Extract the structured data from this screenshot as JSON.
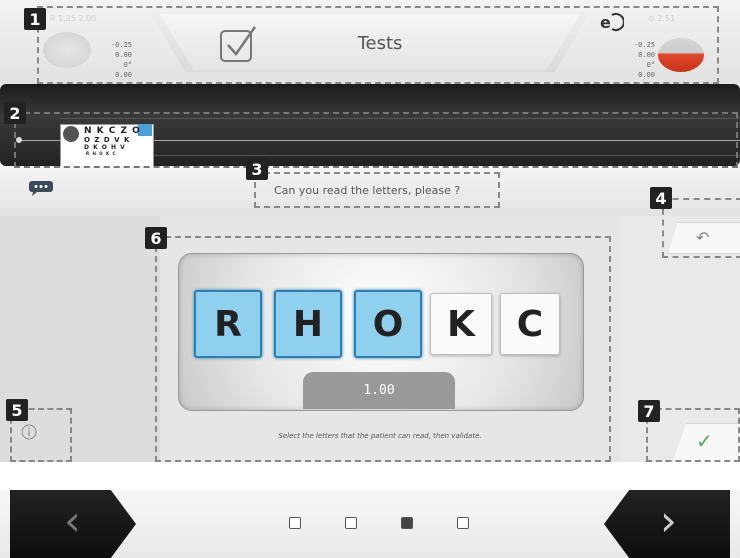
{
  "header": {
    "title": "Tests",
    "right_left_ghost": "R 1.25",
    "right_ghost": "2.00",
    "left_values": [
      "-0.25",
      "0.00",
      "0°",
      "0.00"
    ],
    "right_values": [
      "-0.25",
      "0.00",
      "0°",
      "0.00"
    ]
  },
  "chart_thumb": {
    "letters": [
      "N K C Z O",
      "O Z D V K",
      "D K O H V",
      "R H O K C"
    ]
  },
  "question": "Can you read the letters, please ?",
  "letters": [
    {
      "char": "R",
      "selected": true
    },
    {
      "char": "H",
      "selected": true
    },
    {
      "char": "O",
      "selected": true
    },
    {
      "char": "K",
      "selected": false
    },
    {
      "char": "C",
      "selected": false
    }
  ],
  "acuity": "1.00",
  "instruction": "Select the letters that the patient can read, then validate.",
  "pagination": {
    "count": 4,
    "active_index": 2
  },
  "annotations": [
    "1",
    "2",
    "3",
    "4",
    "5",
    "6",
    "7"
  ],
  "colors": {
    "selected": "#8fd0ee",
    "validate": "#4cb050",
    "eye_right": "#e0482d"
  },
  "icons": {
    "check": "check-square-icon",
    "chat": "chat-bubble-icon",
    "back": "undo-arrow-icon",
    "info": "info-circle-icon",
    "validate": "checkmark-icon",
    "prev": "chevron-left-icon",
    "next": "chevron-right-icon"
  }
}
